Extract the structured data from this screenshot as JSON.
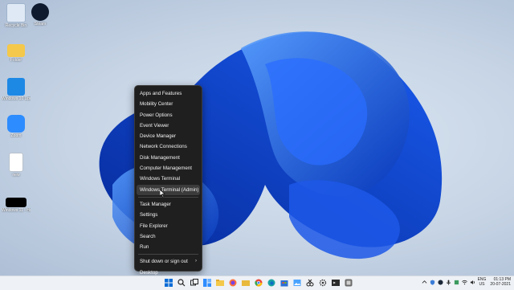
{
  "desktop": {
    "icons": [
      {
        "label": "Recycle Bin",
        "icon": "recycle-bin-icon"
      },
      {
        "label": "Steam",
        "icon": "steam-icon"
      },
      {
        "label": "Folder",
        "icon": "folder-icon"
      },
      {
        "label": "Windows 10 Update As...",
        "icon": "windows-update-icon"
      },
      {
        "label": "Zoom",
        "icon": "zoom-icon"
      },
      {
        "label": "new",
        "icon": "document-icon"
      },
      {
        "label": "Windows 11 - How to fly...",
        "icon": "video-thumbnail-icon"
      }
    ]
  },
  "context_menu": {
    "items": [
      {
        "label": "Apps and Features"
      },
      {
        "label": "Mobility Center"
      },
      {
        "label": "Power Options"
      },
      {
        "label": "Event Viewer"
      },
      {
        "label": "Device Manager"
      },
      {
        "label": "Network Connections"
      },
      {
        "label": "Disk Management"
      },
      {
        "label": "Computer Management"
      },
      {
        "label": "Windows Terminal"
      },
      {
        "label": "Windows Terminal (Admin)",
        "highlighted": true
      },
      {
        "label": "Task Manager"
      },
      {
        "label": "Settings"
      },
      {
        "label": "File Explorer"
      },
      {
        "label": "Search"
      },
      {
        "label": "Run"
      },
      {
        "label": "Shut down or sign out",
        "submenu": true
      },
      {
        "label": "Desktop"
      }
    ],
    "submenu_arrow": "›"
  },
  "taskbar": {
    "pinned": [
      "start-icon",
      "search-icon",
      "task-view-icon",
      "widgets-icon",
      "file-explorer-icon",
      "firefox-icon",
      "folder-icon",
      "chrome-icon",
      "edge-icon",
      "store-icon",
      "photos-icon",
      "snipping-icon",
      "settings-icon",
      "terminal-icon",
      "app-icon"
    ],
    "tray": {
      "lang_top": "ENG",
      "lang_bottom": "US",
      "time": "01:13 PM",
      "date": "20-07-2021"
    }
  },
  "colors": {
    "wallpaper_bg": "#c6d4e5",
    "bloom_dark": "#0a3fc4",
    "bloom_light": "#3b82ff",
    "menu_bg": "#1f1f1f",
    "menu_text": "#f2f2f2",
    "taskbar_bg": "#eef1f5"
  }
}
